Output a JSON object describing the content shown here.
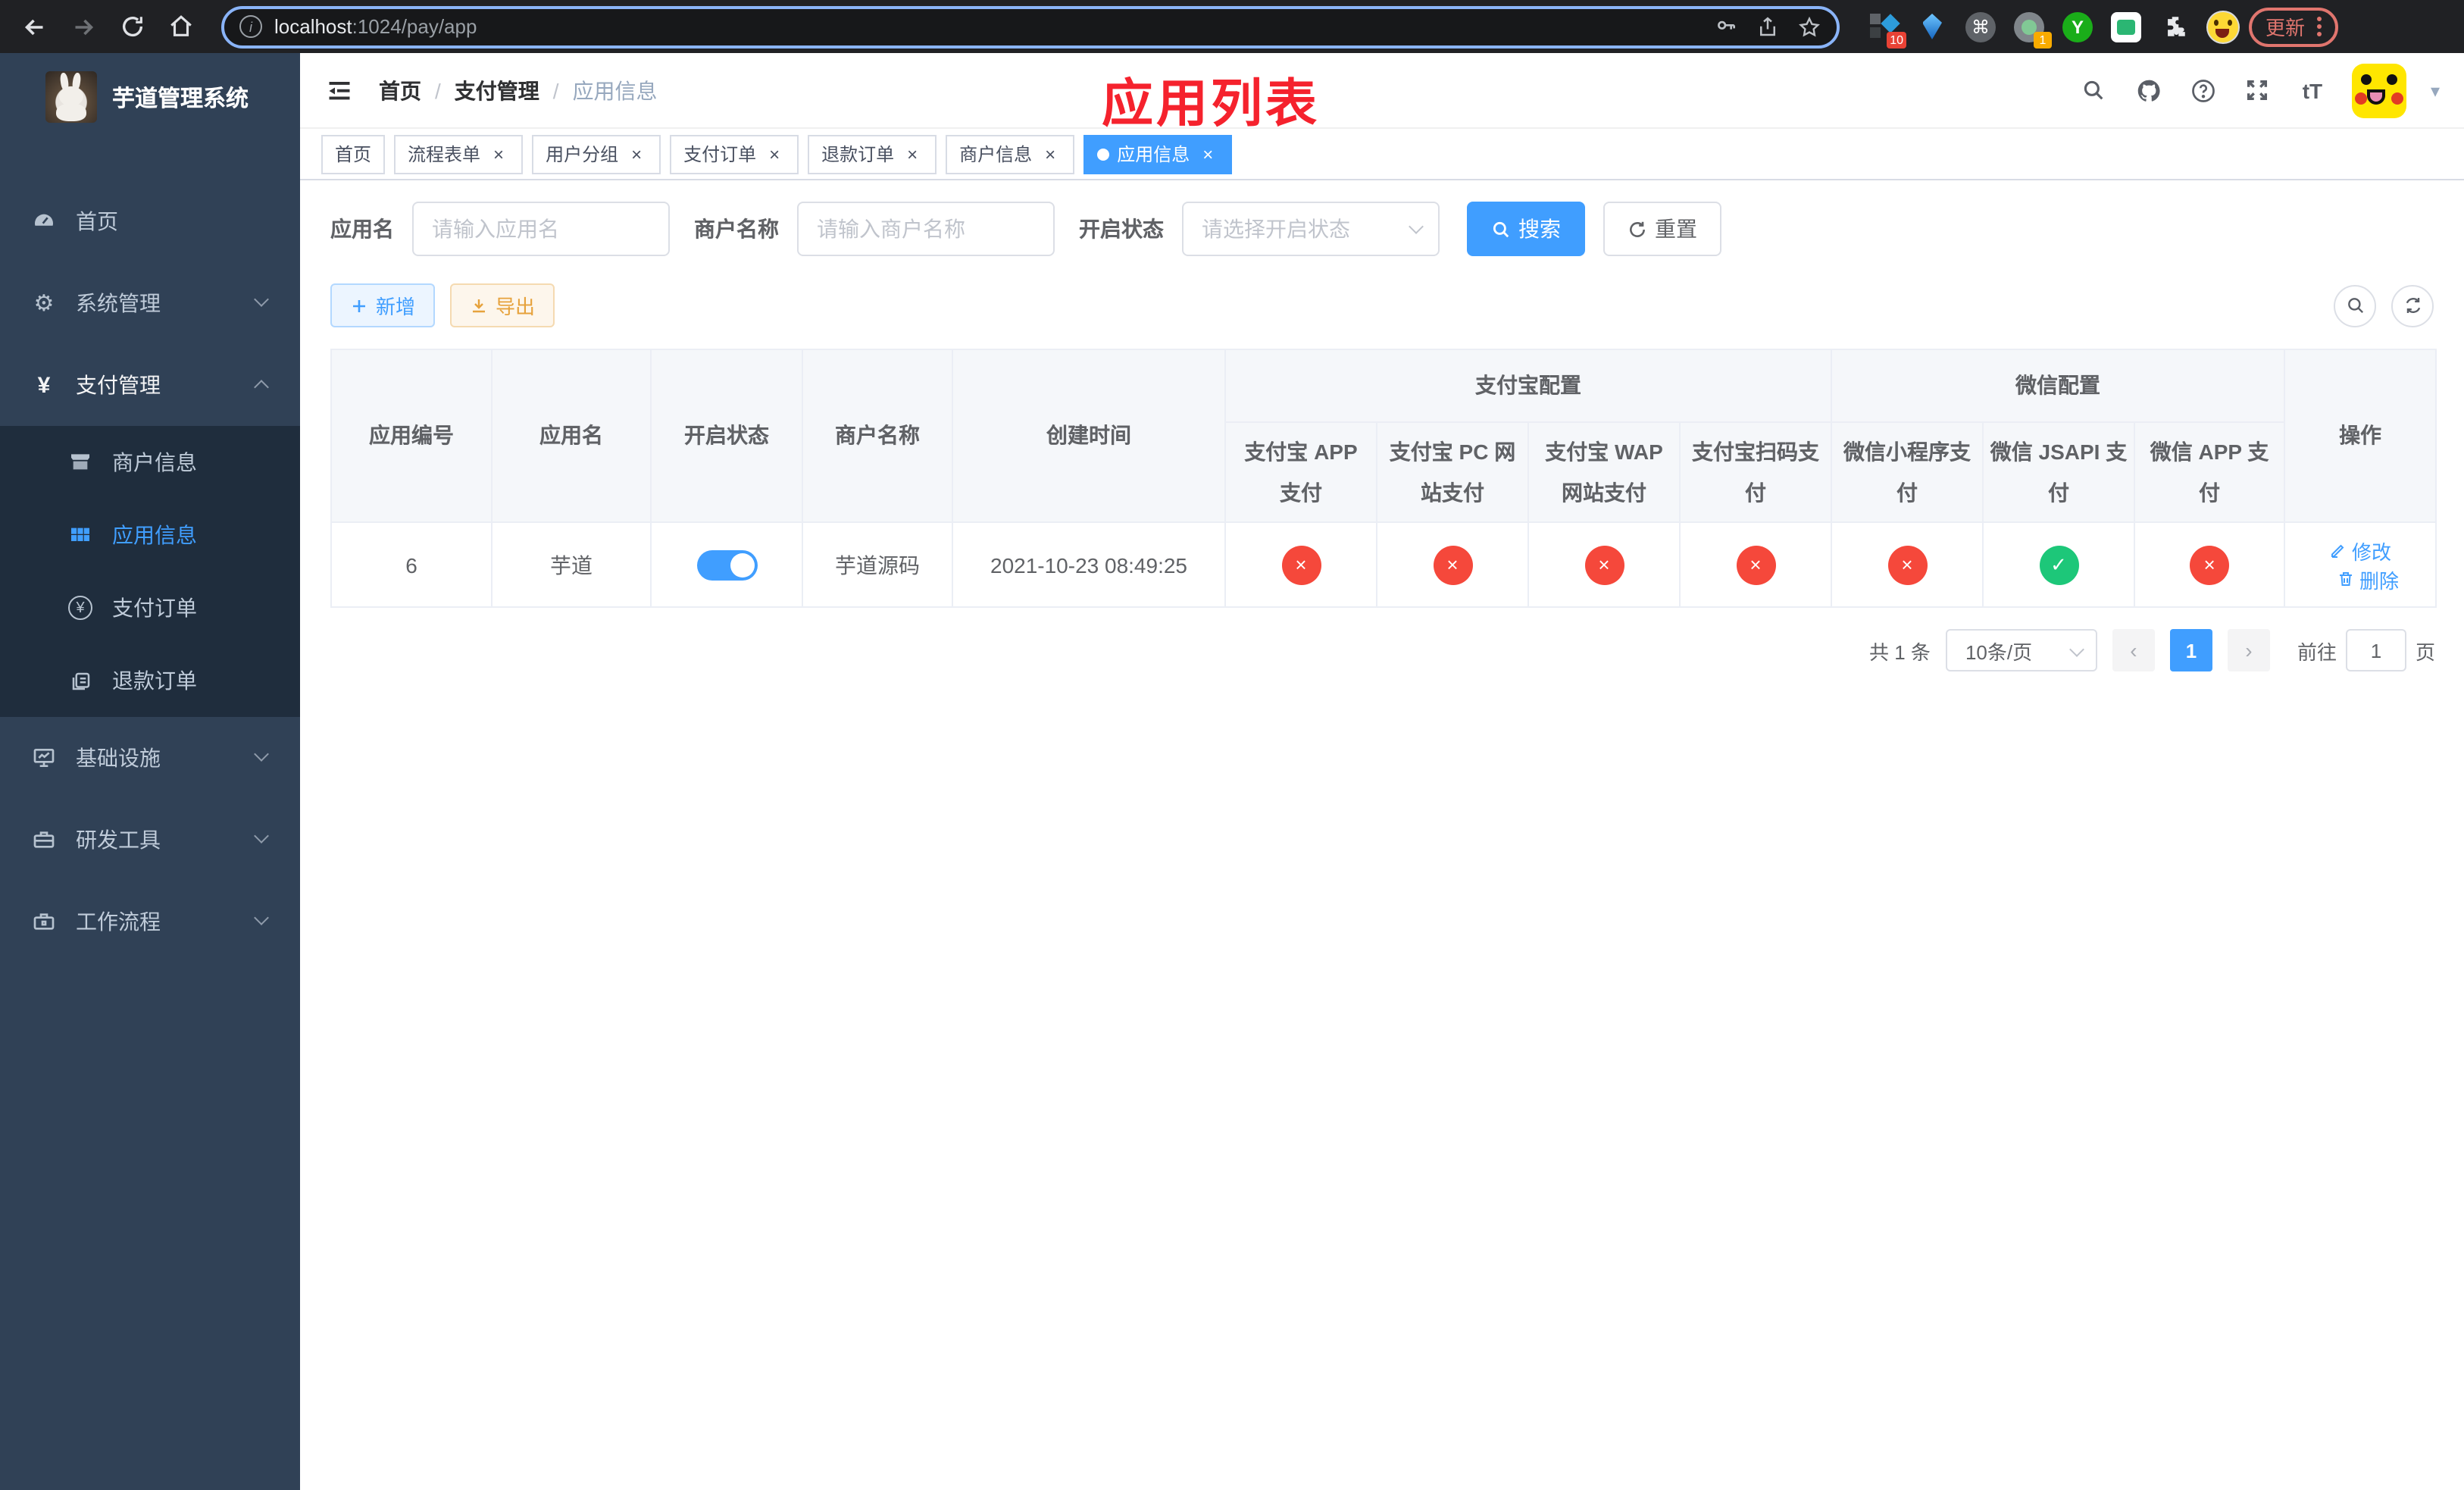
{
  "colors": {
    "accent": "#409eff",
    "success": "#1dc779",
    "danger": "#f5483b",
    "warning": "#e6a23c",
    "sidebar-bg": "#304156",
    "submenu-bg": "#1f2d3d",
    "annotation": "#f5222d"
  },
  "icons": {
    "close": "×",
    "check": "✓",
    "cross": "×",
    "gear": "⚙",
    "pay": "¥",
    "cmd": "⌘",
    "caret": "▾",
    "info": "i",
    "fontsize": "tT",
    "ext_y": "Y",
    "prev": "‹",
    "next": "›"
  },
  "browser": {
    "url_host": "localhost",
    "url_path": ":1024/pay/app",
    "ext_badge_1": "10",
    "ext_badge_2": "1",
    "update_label": "更新"
  },
  "sidebar": {
    "title": "芋道管理系统",
    "items": [
      {
        "label": "首页"
      },
      {
        "label": "系统管理"
      },
      {
        "label": "支付管理",
        "children": [
          {
            "label": "商户信息"
          },
          {
            "label": "应用信息"
          },
          {
            "label": "支付订单"
          },
          {
            "label": "退款订单"
          }
        ]
      },
      {
        "label": "基础设施"
      },
      {
        "label": "研发工具"
      },
      {
        "label": "工作流程"
      }
    ]
  },
  "navbar": {
    "breadcrumb": [
      "首页",
      "支付管理",
      "应用信息"
    ],
    "annotation": "应用列表"
  },
  "tabs": [
    {
      "label": "首页"
    },
    {
      "label": "流程表单"
    },
    {
      "label": "用户分组"
    },
    {
      "label": "支付订单"
    },
    {
      "label": "退款订单"
    },
    {
      "label": "商户信息"
    },
    {
      "label": "应用信息"
    }
  ],
  "filters": {
    "app_name_label": "应用名",
    "app_name_placeholder": "请输入应用名",
    "merchant_label": "商户名称",
    "merchant_placeholder": "请输入商户名称",
    "status_label": "开启状态",
    "status_placeholder": "请选择开启状态",
    "search_label": "搜索",
    "reset_label": "重置"
  },
  "toolbar": {
    "add_label": "新增",
    "export_label": "导出"
  },
  "table": {
    "columns": [
      "应用编号",
      "应用名",
      "开启状态",
      "商户名称",
      "创建时间"
    ],
    "groups": [
      {
        "label": "支付宝配置",
        "children": [
          "支付宝 APP 支付",
          "支付宝 PC 网站支付",
          "支付宝 WAP 网站支付",
          "支付宝扫码支付"
        ]
      },
      {
        "label": "微信配置",
        "children": [
          "微信小程序支付",
          "微信 JSAPI 支付",
          "微信 APP 支付"
        ]
      }
    ],
    "ops_label": "操作",
    "row": {
      "id": "6",
      "name": "芋道",
      "enabled": true,
      "merchant": "芋道源码",
      "created": "2021-10-23 08:49:25",
      "channels": [
        "no",
        "no",
        "no",
        "no",
        "no",
        "yes",
        "no"
      ],
      "edit_label": "修改",
      "delete_label": "删除"
    }
  },
  "pagination": {
    "total": "共 1 条",
    "page_size": "10条/页",
    "page": "1",
    "goto_label": "前往",
    "goto_value": "1",
    "page_suffix": "页"
  }
}
